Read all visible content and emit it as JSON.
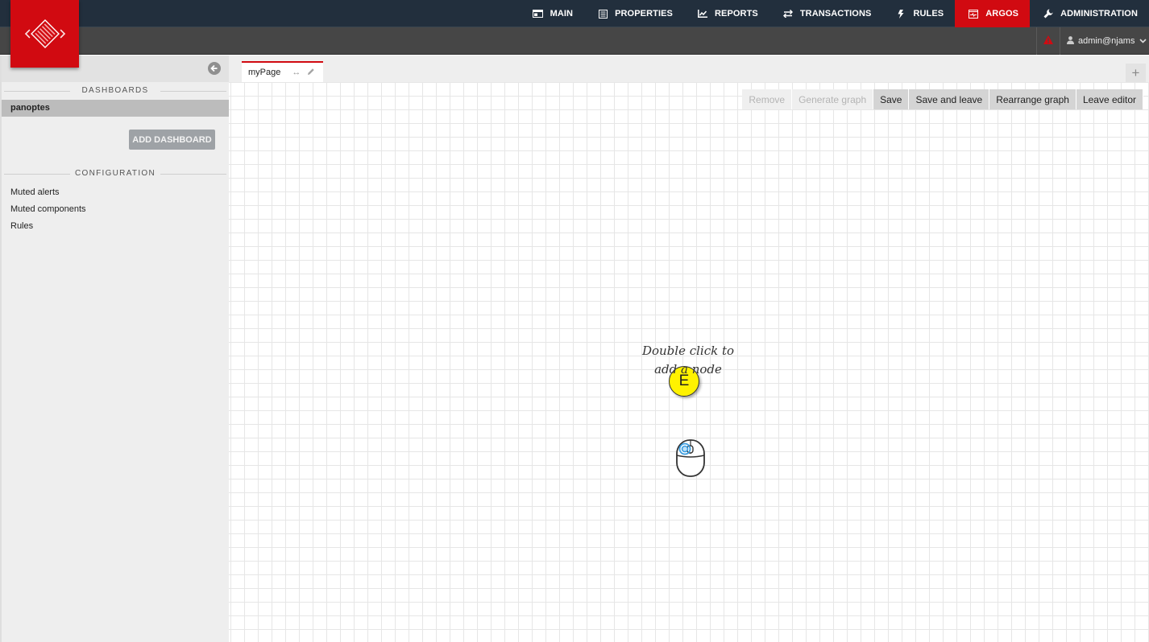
{
  "topnav": {
    "items": [
      {
        "label": "MAIN",
        "icon": "window-icon",
        "active": false
      },
      {
        "label": "PROPERTIES",
        "icon": "list-icon",
        "active": false
      },
      {
        "label": "REPORTS",
        "icon": "chart-icon",
        "active": false
      },
      {
        "label": "TRANSACTIONS",
        "icon": "exchange-icon",
        "active": false
      },
      {
        "label": "RULES",
        "icon": "bolt-icon",
        "active": false
      },
      {
        "label": "ARGOS",
        "icon": "monitor-icon",
        "active": true
      },
      {
        "label": "ADMINISTRATION",
        "icon": "wrench-icon",
        "active": false
      }
    ],
    "accent_color": "#d10a11"
  },
  "subbar": {
    "alert_icon": "warning-icon",
    "user_label": "admin@njams"
  },
  "sidebar": {
    "dashboards_title": "DASHBOARDS",
    "dashboards": [
      {
        "label": "panoptes",
        "selected": true
      }
    ],
    "add_dashboard_label": "ADD DASHBOARD",
    "configuration_title": "CONFIGURATION",
    "configuration_items": [
      {
        "label": "Muted alerts"
      },
      {
        "label": "Muted components"
      },
      {
        "label": "Rules"
      }
    ]
  },
  "tabs": [
    {
      "label": "myPage",
      "active": true
    }
  ],
  "add_tab_label": "+",
  "toolbar": {
    "buttons": [
      {
        "label": "Remove",
        "disabled": true
      },
      {
        "label": "Generate graph",
        "disabled": true
      },
      {
        "label": "Save",
        "disabled": false
      },
      {
        "label": "Save and leave",
        "disabled": false
      },
      {
        "label": "Rearrange graph",
        "disabled": false
      },
      {
        "label": "Leave editor",
        "disabled": false
      }
    ]
  },
  "canvas": {
    "badge_label": "E",
    "hint_line1": "Double click to",
    "hint_line2": "add a node"
  }
}
